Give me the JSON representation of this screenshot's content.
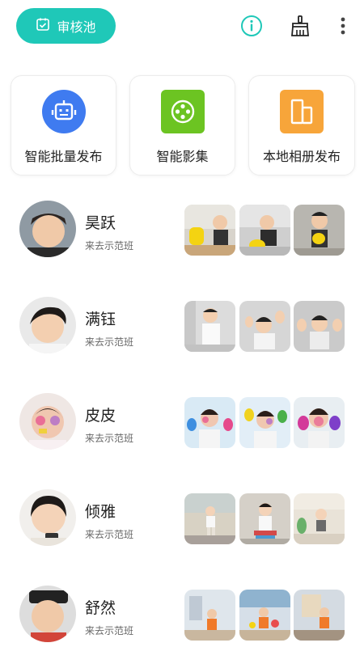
{
  "topbar": {
    "review_label": "审核池",
    "icons": [
      "calendar-check-icon",
      "info-icon",
      "broom-icon",
      "more-vertical-icon"
    ],
    "accent": "#1fc8b8"
  },
  "cards": [
    {
      "label": "智能批量发布",
      "icon": "robot-icon",
      "color": "#3f7bf0"
    },
    {
      "label": "智能影集",
      "icon": "film-reel-icon",
      "color": "#6cc422"
    },
    {
      "label": "本地相册发布",
      "icon": "album-icon",
      "color": "#f7a53a"
    }
  ],
  "kids": [
    {
      "name": "昊跃",
      "subtitle": "来去示范班"
    },
    {
      "name": "满钰",
      "subtitle": "来去示范班"
    },
    {
      "name": "皮皮",
      "subtitle": "来去示范班"
    },
    {
      "name": "倾雅",
      "subtitle": "来去示范班"
    },
    {
      "name": "舒然",
      "subtitle": "来去示范班"
    }
  ]
}
